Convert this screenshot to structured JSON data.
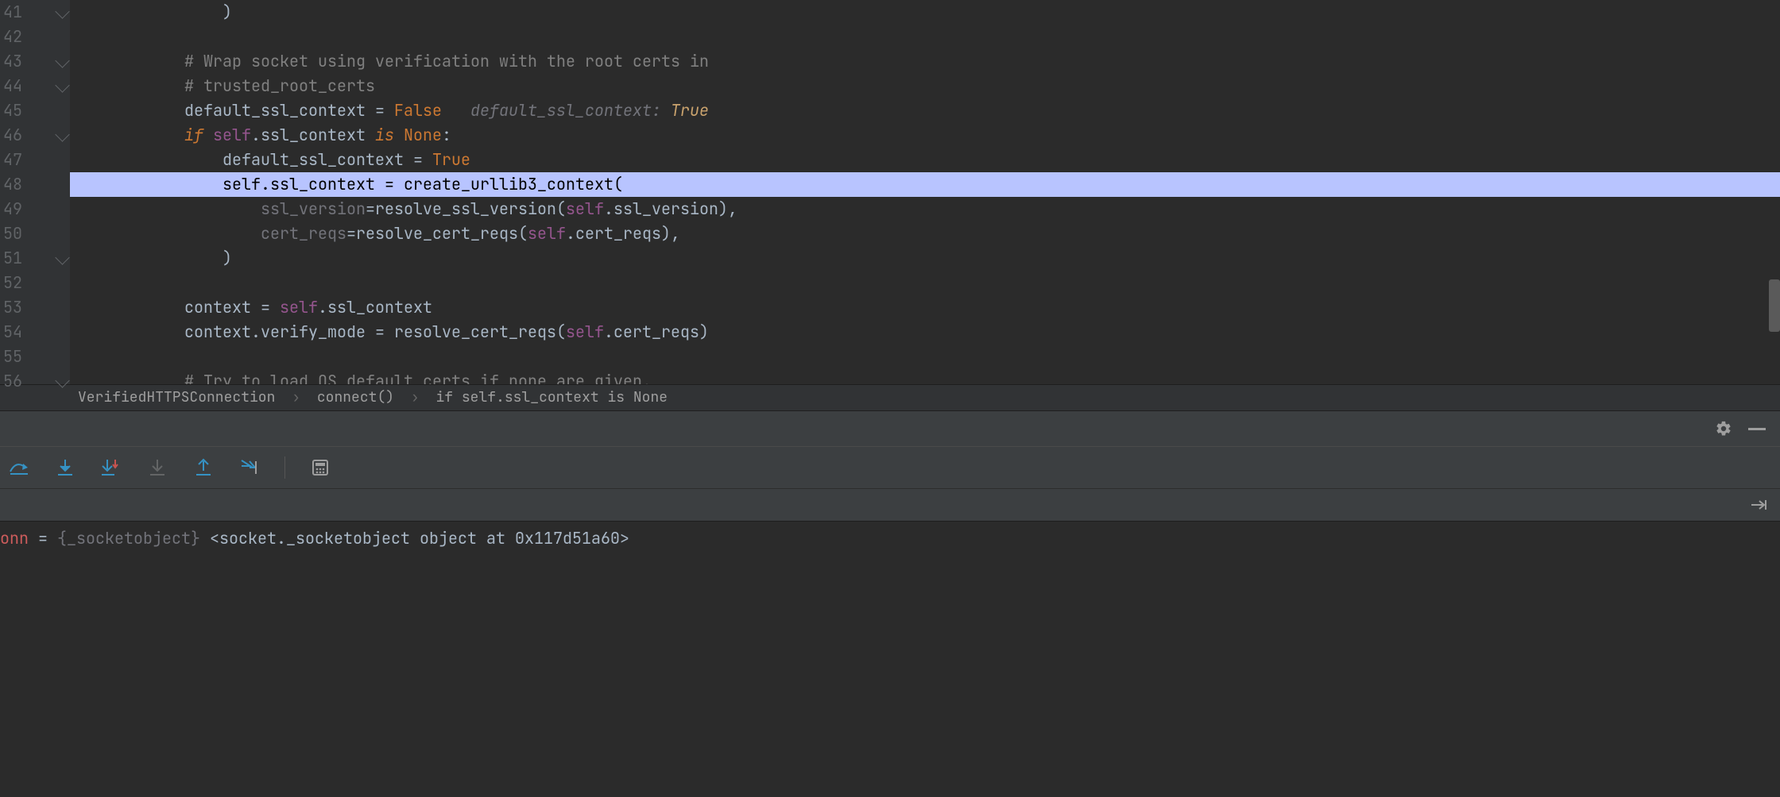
{
  "line_numbers": [
    "41",
    "42",
    "43",
    "44",
    "45",
    "46",
    "47",
    "48",
    "49",
    "50",
    "51",
    "52",
    "53",
    "54",
    "55",
    "56"
  ],
  "breakpoint_line": "48",
  "code": {
    "l41": {
      "indent": "                ",
      "t": ")"
    },
    "l43": "            # Wrap socket using verification with the root certs in",
    "l44": "            # trusted_root_certs",
    "l45": {
      "indent": "            ",
      "a": "default_ssl_context ",
      "eq": "= ",
      "v": "False",
      "hint_k": "   default_ssl_context: ",
      "hint_v": "True"
    },
    "l46": {
      "indent": "            ",
      "if": "if ",
      "self": "self",
      "dot": ".",
      "m": "ssl_context ",
      "is": "is ",
      "none": "None",
      "c": ":"
    },
    "l47": {
      "indent": "                ",
      "a": "default_ssl_context ",
      "eq": "= ",
      "v": "True"
    },
    "l48": {
      "indent": "                ",
      "self": "self",
      "dot": ".",
      "m": "ssl_context ",
      "eq": "= ",
      "fn": "create_urllib3_context",
      "p": "("
    },
    "l49": {
      "indent": "                    ",
      "an": "ssl_version",
      "eq": "=",
      "fn": "resolve_ssl_version",
      "p": "(",
      "self": "self",
      "dot": ".",
      "attr": "ssl_version",
      "pc": "),"
    },
    "l50": {
      "indent": "                    ",
      "an": "cert_reqs",
      "eq": "=",
      "fn": "resolve_cert_reqs",
      "p": "(",
      "self": "self",
      "dot": ".",
      "attr": "cert_reqs",
      "pc": "),"
    },
    "l51": {
      "indent": "                ",
      "t": ")"
    },
    "l53": {
      "indent": "            ",
      "a": "context ",
      "eq": "= ",
      "self": "self",
      "dot": ".",
      "m": "ssl_context"
    },
    "l54": {
      "indent": "            ",
      "a": "context",
      "dot": ".",
      "m": "verify_mode ",
      "eq": "= ",
      "fn": "resolve_cert_reqs",
      "p": "(",
      "self": "self",
      "dot2": ".",
      "attr": "cert_reqs",
      "pc": ")"
    },
    "l56": "            # Try to load OS default certs if none are given."
  },
  "breadcrumb": {
    "a": "VerifiedHTTPSConnection",
    "b": "connect()",
    "c": "if self.ssl_context is None"
  },
  "toolbar_icons": [
    "step-over",
    "step-into",
    "step-into-my",
    "force-step",
    "step-out",
    "run-to-cursor",
    "evaluate"
  ],
  "variable": {
    "name": "onn",
    "eq": " = ",
    "type": "{_socketobject}",
    "val": " <socket._socketobject object at 0x117d51a60>"
  }
}
